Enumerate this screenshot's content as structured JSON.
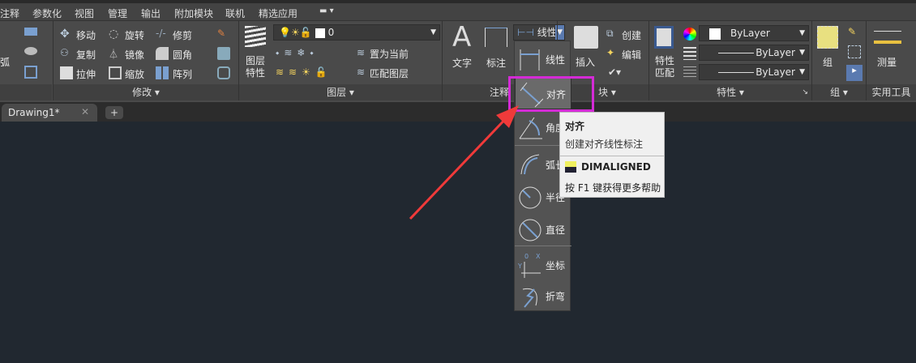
{
  "menu_tabs": [
    "注释",
    "参数化",
    "视图",
    "管理",
    "输出",
    "附加模块",
    "联机",
    "精选应用"
  ],
  "panels": {
    "draw_partial": {
      "arc": "弧"
    },
    "modify": {
      "title": "修改",
      "items": [
        "移动",
        "旋转",
        "修剪",
        "复制",
        "镜像",
        "圆角",
        "拉伸",
        "缩放",
        "阵列"
      ]
    },
    "layers": {
      "title": "图层",
      "layer_props": "图层特性",
      "layer_combo": "0",
      "set_current": "置为当前",
      "match_layer": "匹配图层"
    },
    "annotation": {
      "title": "注释",
      "text": "文字",
      "dimension": "标注",
      "dim_combo": "线性"
    },
    "block": {
      "title": "块",
      "insert": "插入",
      "create": "创建",
      "edit": "编辑"
    },
    "properties": {
      "title": "特性",
      "match": "特性匹配",
      "color": "ByLayer",
      "linetype": "ByLayer",
      "lineweight": "ByLayer"
    },
    "group": {
      "title": "组",
      "group": "组"
    },
    "utilities": {
      "title": "实用工具",
      "measure": "测量"
    }
  },
  "doc_tab": {
    "name": "Drawing1*"
  },
  "dim_dropdown": [
    "线性",
    "对齐",
    "角度",
    "弧长",
    "半径",
    "直径",
    "坐标",
    "折弯"
  ],
  "tooltip": {
    "title": "对齐",
    "desc": "创建对齐线性标注",
    "command": "DIMALIGNED",
    "help": "按 F1 键获得更多帮助"
  },
  "colors": {
    "highlight": "#d42bd6",
    "arrow": "#f03a3a"
  }
}
